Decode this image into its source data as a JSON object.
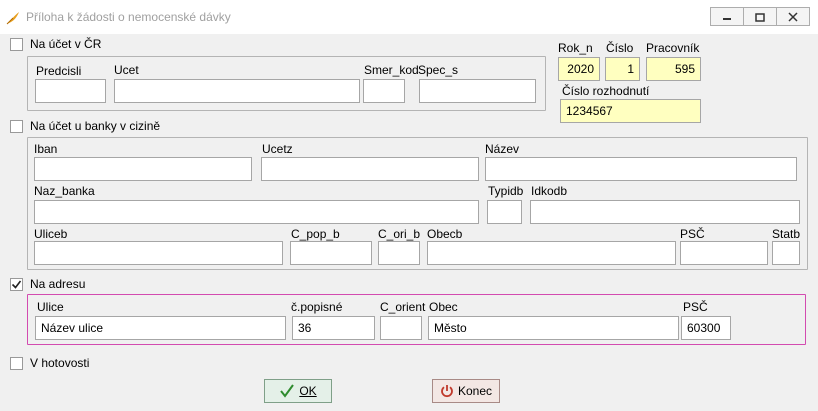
{
  "window": {
    "title": "Příloha k žádosti o nemocenské dávky",
    "icons": {
      "app": "feather-icon",
      "minimize": "minimize-icon",
      "restore": "restore-icon",
      "close": "close-icon"
    }
  },
  "ucet_cr": {
    "checkbox_label": "Na účet v ČR",
    "checked": false,
    "labels": {
      "predcisli": "Predcisli",
      "ucet": "Ucet",
      "smer_kod": "Smer_kod",
      "spec_s": "Spec_s"
    },
    "values": {
      "predcisli": "",
      "ucet": "",
      "smer_kod": "",
      "spec_s": ""
    }
  },
  "meta": {
    "labels": {
      "rok_n": "Rok_n",
      "cislo": "Číslo",
      "pracovnik": "Pracovník",
      "cislo_rozhodnuti": "Číslo rozhodnutí"
    },
    "values": {
      "rok_n": "2020",
      "cislo": "1",
      "pracovnik": "595",
      "cislo_rozhodnuti": "1234567"
    }
  },
  "ucet_ciz": {
    "checkbox_label": "Na účet u banky v cizině",
    "checked": false,
    "labels": {
      "iban": "Iban",
      "ucetz": "Ucetz",
      "nazev": "Název",
      "naz_banka": "Naz_banka",
      "typidb": "Typidb",
      "idkodb": "Idkodb",
      "uliceb": "Uliceb",
      "c_pop_b": "C_pop_b",
      "c_ori_b": "C_ori_b",
      "obecb": "Obecb",
      "psc": "PSČ",
      "statb": "Statb"
    },
    "values": {
      "iban": "",
      "ucetz": "",
      "nazev": "",
      "naz_banka": "",
      "typidb": "",
      "idkodb": "",
      "uliceb": "",
      "c_pop_b": "",
      "c_ori_b": "",
      "obecb": "",
      "psc": "",
      "statb": ""
    }
  },
  "adresa": {
    "checkbox_label": "Na adresu",
    "checked": true,
    "labels": {
      "ulice": "Ulice",
      "c_popisne": "č.popisné",
      "c_orient": "C_orient",
      "obec": "Obec",
      "psc": "PSČ"
    },
    "values": {
      "ulice": "Název ulice",
      "c_popisne": "36",
      "c_orient": "",
      "obec": "Město",
      "psc": "60300"
    }
  },
  "hotovost": {
    "checkbox_label": "V hotovosti",
    "checked": false
  },
  "buttons": {
    "ok": "OK",
    "konec": "Konec"
  },
  "colors": {
    "highlight_border": "#d34bb0",
    "readonly_bg": "#ffffc0",
    "ok_icon": "#2e8b2e",
    "konec_icon": "#c0392b"
  }
}
